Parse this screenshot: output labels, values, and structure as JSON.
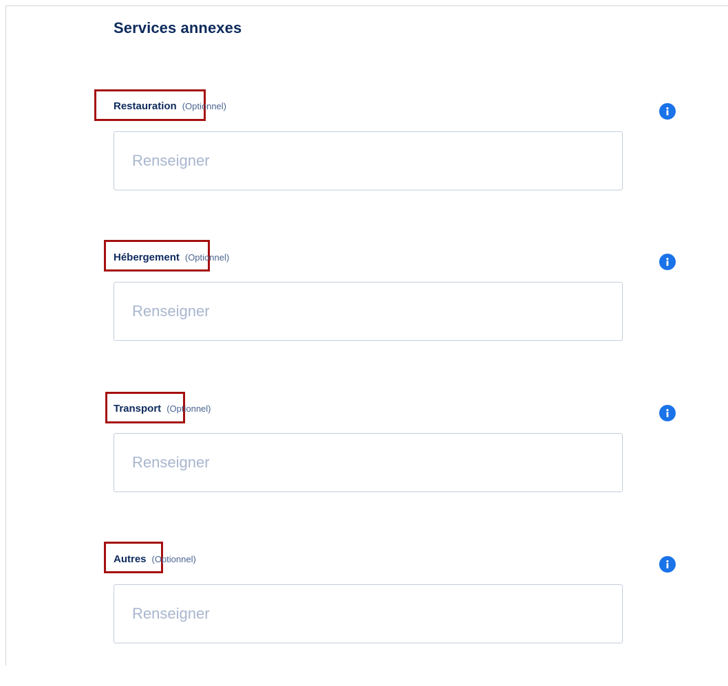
{
  "section": {
    "title": "Services annexes"
  },
  "fields": [
    {
      "label": "Restauration",
      "optional": "(Optionnel)",
      "placeholder": "Renseigner",
      "value": ""
    },
    {
      "label": "Hébergement",
      "optional": "(Optionnel)",
      "placeholder": "Renseigner",
      "value": ""
    },
    {
      "label": "Transport",
      "optional": "(Optionnel)",
      "placeholder": "Renseigner",
      "value": ""
    },
    {
      "label": "Autres",
      "optional": "(Optionnel)",
      "placeholder": "Renseigner",
      "value": ""
    }
  ],
  "icons": {
    "info": "info-icon"
  },
  "colors": {
    "title": "#0d2a5c",
    "optional_text": "#4a6390",
    "highlight": "#a50f0f",
    "info_icon": "#1a73e8",
    "input_border": "#c4cddd",
    "placeholder": "#a8b6cf"
  }
}
